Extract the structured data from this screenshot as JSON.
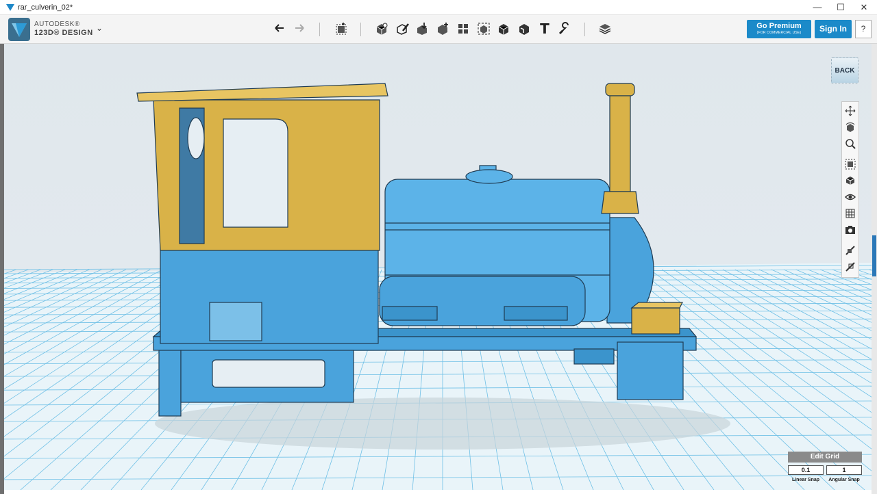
{
  "window": {
    "title": "rar_culverin_02*",
    "minimize_glyph": "—",
    "maximize_glyph": "☐",
    "close_glyph": "✕"
  },
  "app": {
    "brand_top": "AUTODESK®",
    "brand_bottom": "123D® DESIGN",
    "menu_glyph": "⌄"
  },
  "toolbar": {
    "tools": [
      "undo-icon",
      "redo-icon",
      "transform-icon",
      "primitives-icon",
      "sketch-icon",
      "construct-icon",
      "modify-icon",
      "pattern-icon",
      "grouping-icon",
      "combine-icon",
      "measure-icon",
      "text-icon",
      "snap-icon",
      "material-icon"
    ],
    "text_tool_glyph": "T"
  },
  "account": {
    "premium_label": "Go Premium",
    "premium_sub": "(FOR COMMERCIAL USE)",
    "signin_label": "Sign In",
    "help_label": "?"
  },
  "viewcube": {
    "back_label": "BACK"
  },
  "navbar": {
    "tools": [
      "pan-icon",
      "orbit-icon",
      "zoom-icon",
      "fit-icon",
      "view-icon",
      "visibility-icon",
      "materials-outline-icon",
      "camera-icon",
      "snap-fit-icon",
      "extra-icon"
    ]
  },
  "grid_panel": {
    "edit_grid_label": "Edit Grid",
    "linear_snap_value": "0.1",
    "linear_snap_label": "Linear Snap",
    "angular_snap_value": "1",
    "angular_snap_label": "Angular Snap"
  },
  "colors": {
    "accent": "#1b8ac9",
    "model_blue": "#4aa3dc",
    "model_gold": "#d9b248",
    "grid_line": "#5fb8e2"
  }
}
